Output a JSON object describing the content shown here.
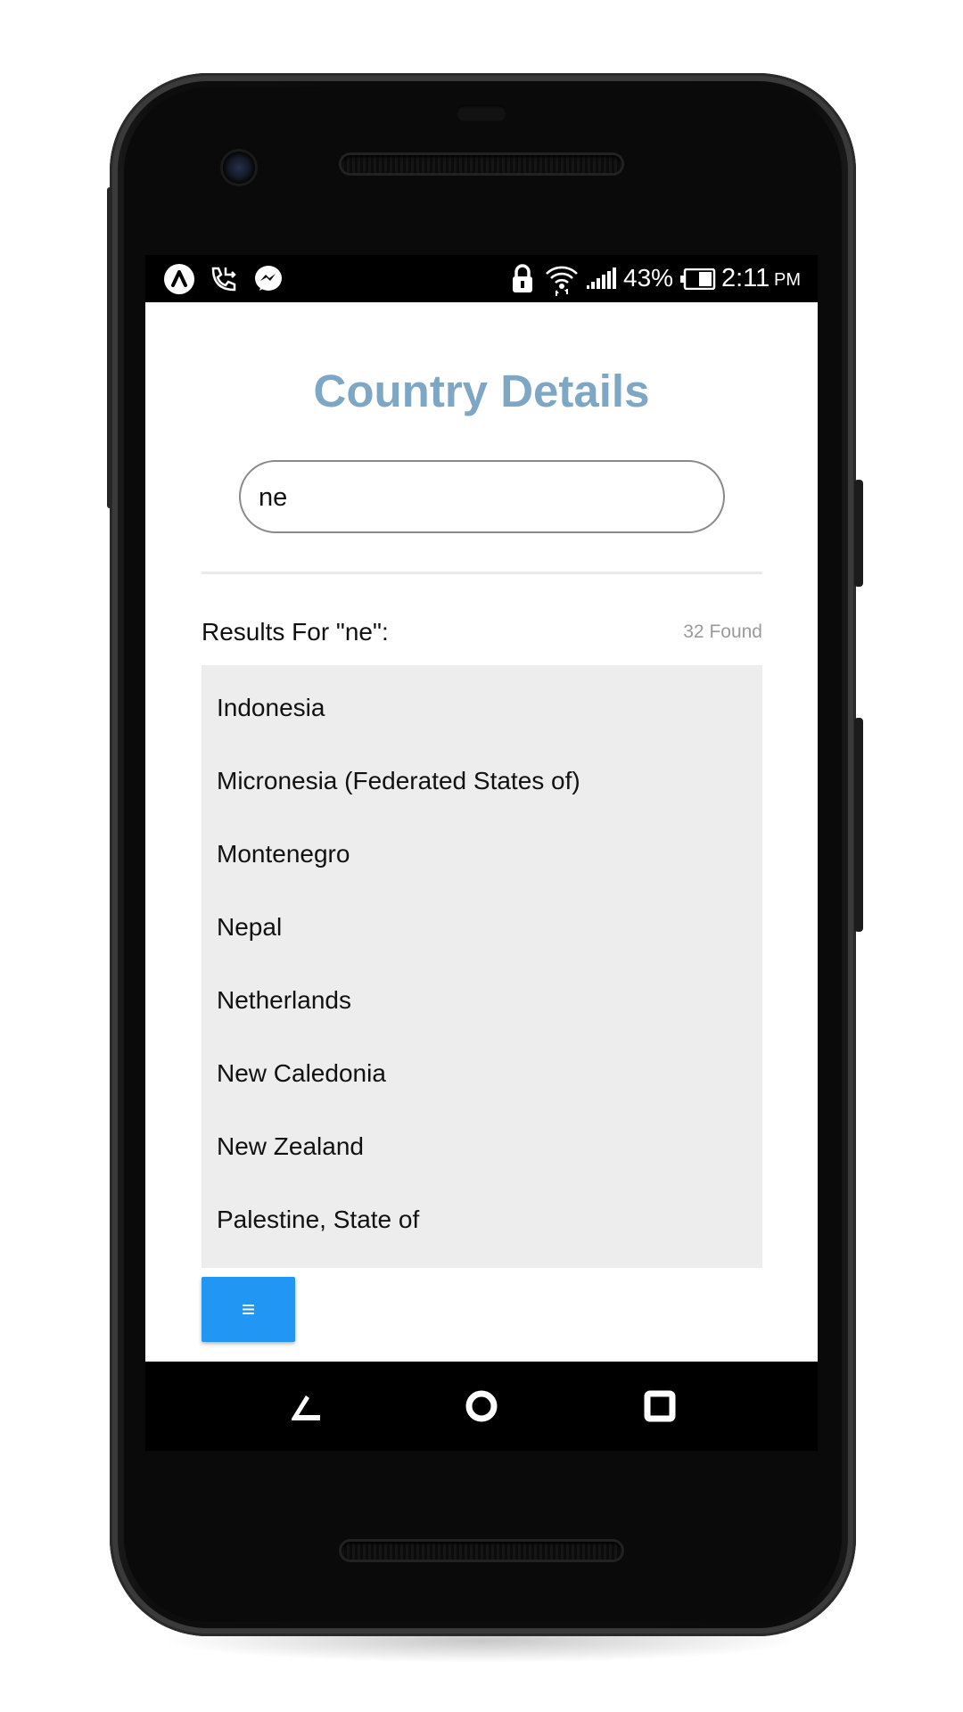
{
  "status_bar": {
    "left_icons": [
      "app-logo-icon",
      "call-forward-icon",
      "messenger-icon"
    ],
    "right_icons": [
      "lock-icon",
      "wifi-icon",
      "signal-icon",
      "battery-icon"
    ],
    "battery": "43%",
    "time": "2:11",
    "ampm": "PM"
  },
  "app": {
    "title": "Country Details",
    "search": {
      "value": "ne",
      "placeholder": ""
    },
    "results_label": "Results For \"ne\":",
    "found": "32 Found",
    "countries": [
      "Indonesia",
      "Micronesia (Federated States of)",
      "Montenegro",
      "Nepal",
      "Netherlands",
      "New Caledonia",
      "New Zealand",
      "Palestine, State of"
    ],
    "menu_button": "≡",
    "accent_color": "#2196f3",
    "title_color": "#7ea7c5"
  },
  "nav_bar": {
    "buttons": [
      "back-icon",
      "home-icon",
      "recents-icon"
    ]
  }
}
